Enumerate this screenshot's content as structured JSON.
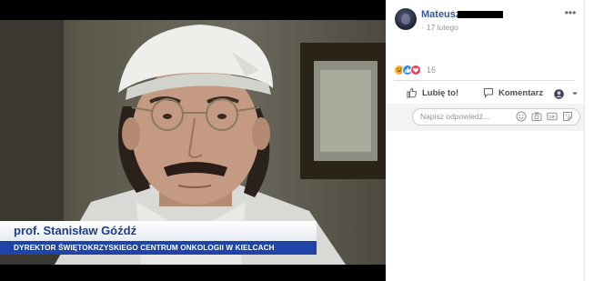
{
  "video_overlay": {
    "name": "prof. Stanisław Góźdź",
    "title": "DYREKTOR ŚWIĘTOKRZYSKIEGO CENTRUM ONKOLOGII W KIELCACH"
  },
  "post": {
    "author": "Mateusz",
    "date": "17 lutego",
    "reaction_count": "16",
    "reactions": [
      "haha-icon",
      "like-icon",
      "love-icon"
    ]
  },
  "actions": {
    "like_label": "Lubię to!",
    "comment_label": "Komentarz"
  },
  "comment_box": {
    "placeholder": "Napisz odpowiedź..."
  },
  "colors": {
    "link_blue": "#385898",
    "tv_blue": "#1d44a6",
    "tv_name_blue": "#1b3d8f"
  }
}
